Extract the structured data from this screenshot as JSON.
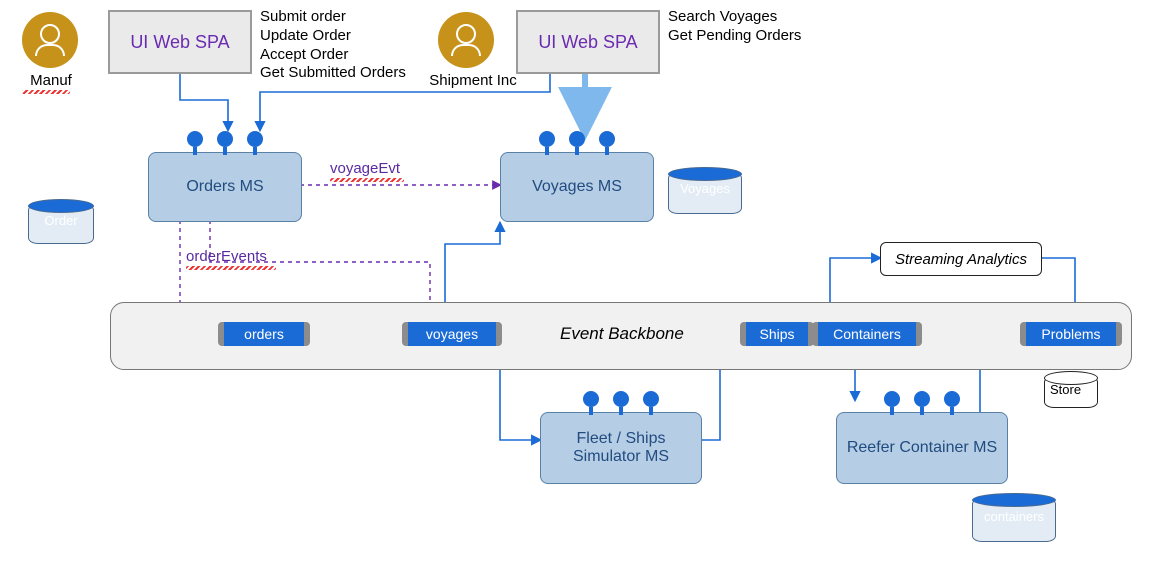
{
  "actors": {
    "manuf": "Manuf",
    "shipment": "Shipment Inc"
  },
  "ui_box_label": "UI Web SPA",
  "manuf_actions": "Submit order\nUpdate Order\nAccept Order\nGet Submitted Orders",
  "shipment_actions": "Search Voyages\nGet Pending Orders",
  "services": {
    "orders": "Orders MS",
    "voyages": "Voyages\nMS",
    "fleet": "Fleet / Ships\nSimulator MS",
    "reefer": "Reefer Container\nMS"
  },
  "databases": {
    "order": "Order",
    "voyages": "Voyages",
    "containers": "containers",
    "store": "Store"
  },
  "backbone_label": "Event Backbone",
  "topics": {
    "orders": "orders",
    "voyages": "voyages",
    "ships": "Ships",
    "containers": "Containers",
    "problems": "Problems"
  },
  "event_labels": {
    "voyageEvt": "voyageEvt",
    "orderEvents": "orderEvents"
  },
  "streaming_analytics": "Streaming Analytics"
}
